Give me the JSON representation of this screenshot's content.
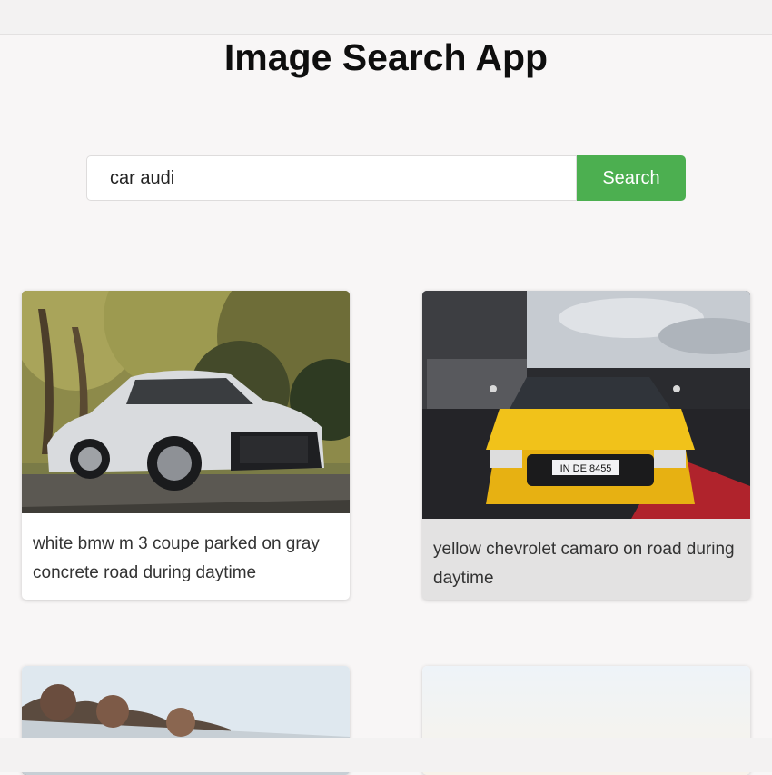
{
  "app": {
    "title": "Image Search App"
  },
  "search": {
    "query": "car audi",
    "button_label": "Search"
  },
  "results": [
    {
      "caption": "white bmw m 3 coupe parked on gray concrete road during daytime",
      "image": "white-sports-car-photo"
    },
    {
      "caption": "yellow chevrolet camaro on road during daytime",
      "image": "yellow-sports-car-photo",
      "plate": "IN DE 8455"
    },
    {
      "caption": "",
      "image": "trees-landscape-photo"
    },
    {
      "caption": "",
      "image": "sky-photo"
    }
  ],
  "colors": {
    "accent": "#4caf50",
    "background": "#f8f6f6",
    "card_hover": "#e3e2e2"
  }
}
